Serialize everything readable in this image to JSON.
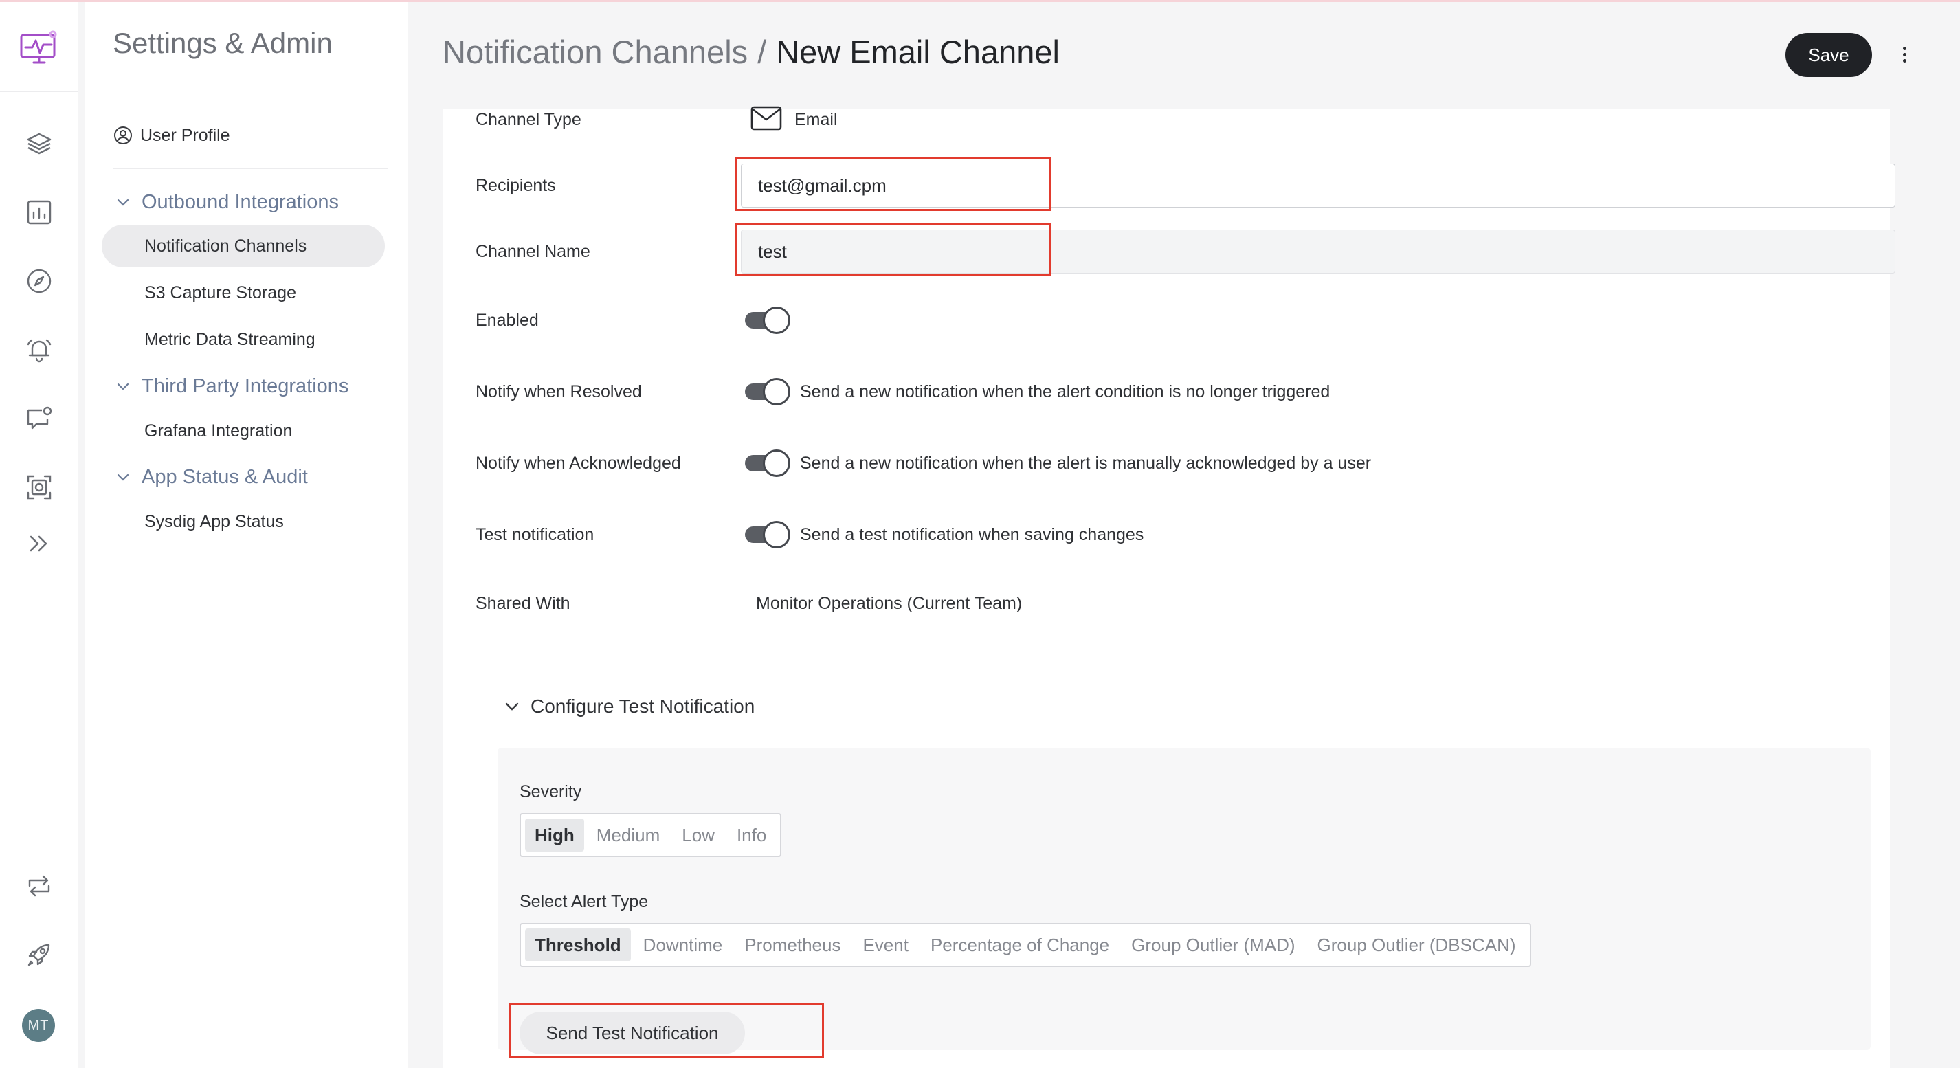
{
  "sidebar": {
    "title": "Settings & Admin",
    "user_profile": "User Profile",
    "groups": [
      {
        "label": "Outbound Integrations",
        "items": [
          "Notification Channels",
          "S3 Capture Storage",
          "Metric Data Streaming"
        ]
      },
      {
        "label": "Third Party Integrations",
        "items": [
          "Grafana Integration"
        ]
      },
      {
        "label": "App Status & Audit",
        "items": [
          "Sysdig App Status"
        ]
      }
    ],
    "active_item": "Notification Channels"
  },
  "rail": {
    "icons": [
      "monitor-logo-icon",
      "layers-icon",
      "bar-chart-icon",
      "compass-icon",
      "bell-icon",
      "chat-icon",
      "capture-icon",
      "chevrons-right-icon",
      "sync-icon",
      "rocket-icon"
    ],
    "avatar_initials": "MT",
    "brand_color": "#a34ec8"
  },
  "header": {
    "breadcrumb_parent": "Notification Channels",
    "breadcrumb_sep": "/",
    "breadcrumb_current": "New Email Channel",
    "save_label": "Save"
  },
  "form": {
    "channel_type_label": "Channel Type",
    "channel_type_value": "Email",
    "recipients_label": "Recipients",
    "recipients_value": "test@gmail.cpm",
    "channel_name_label": "Channel Name",
    "channel_name_value": "test",
    "enabled_label": "Enabled",
    "enabled": true,
    "notify_resolved_label": "Notify when Resolved",
    "notify_resolved_desc": "Send a new notification when the alert condition is no longer triggered",
    "notify_resolved": true,
    "notify_ack_label": "Notify when Acknowledged",
    "notify_ack_desc": "Send a new notification when the alert is manually acknowledged by a user",
    "notify_ack": true,
    "test_notification_label": "Test notification",
    "test_notification_desc": "Send a test notification when saving changes",
    "test_notification": true,
    "shared_with_label": "Shared With",
    "shared_with_value": "Monitor Operations (Current Team)"
  },
  "configure_test": {
    "title": "Configure Test Notification",
    "severity_label": "Severity",
    "severity_options": [
      "High",
      "Medium",
      "Low",
      "Info"
    ],
    "severity_selected": "High",
    "alert_type_label": "Select Alert Type",
    "alert_type_options": [
      "Threshold",
      "Downtime",
      "Prometheus",
      "Event",
      "Percentage of Change",
      "Group Outlier (MAD)",
      "Group Outlier (DBSCAN)"
    ],
    "alert_type_selected": "Threshold",
    "send_button_label": "Send Test Notification"
  },
  "highlight_color": "#e23b2e"
}
